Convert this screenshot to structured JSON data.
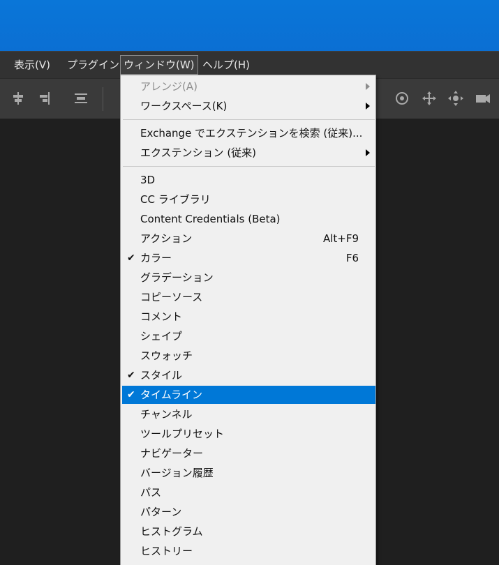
{
  "menubar": {
    "items": [
      {
        "label": "表示(V)"
      },
      {
        "label": "プラグイン"
      },
      {
        "label": "ウィンドウ(W)"
      },
      {
        "label": "ヘルプ(H)"
      }
    ]
  },
  "toolbar": {
    "icons": [
      "align-left-icon",
      "align-right-icon",
      "distribute-icon",
      "rotate-3d-icon",
      "pan-3d-icon",
      "slide-3d-icon",
      "camera-3d-icon"
    ]
  },
  "window_menu": {
    "items": [
      {
        "label": "アレンジ(A)",
        "disabled": true,
        "submenu": true
      },
      {
        "label": "ワークスペース(K)",
        "submenu": true
      },
      {
        "label": "Exchange でエクステンションを検索 (従来)..."
      },
      {
        "label": "エクステンション (従来)",
        "submenu": true
      },
      {
        "label": "3D"
      },
      {
        "label": "CC ライブラリ"
      },
      {
        "label": "Content Credentials (Beta)"
      },
      {
        "label": "アクション",
        "shortcut": "Alt+F9"
      },
      {
        "label": "カラー",
        "shortcut": "F6",
        "checked": true
      },
      {
        "label": "グラデーション"
      },
      {
        "label": "コピーソース"
      },
      {
        "label": "コメント"
      },
      {
        "label": "シェイプ"
      },
      {
        "label": "スウォッチ"
      },
      {
        "label": "スタイル",
        "checked": true
      },
      {
        "label": "タイムライン",
        "checked": true,
        "highlighted": true
      },
      {
        "label": "チャンネル"
      },
      {
        "label": "ツールプリセット"
      },
      {
        "label": "ナビゲーター"
      },
      {
        "label": "バージョン履歴"
      },
      {
        "label": "パス"
      },
      {
        "label": "パターン"
      },
      {
        "label": "ヒストグラム"
      },
      {
        "label": "ヒストリー"
      }
    ],
    "check_glyph": "✔"
  },
  "colors": {
    "desktop": "#0b72d6",
    "menubar": "#323232",
    "menu_bg": "#f0f0f0",
    "highlight": "#0078d7"
  }
}
